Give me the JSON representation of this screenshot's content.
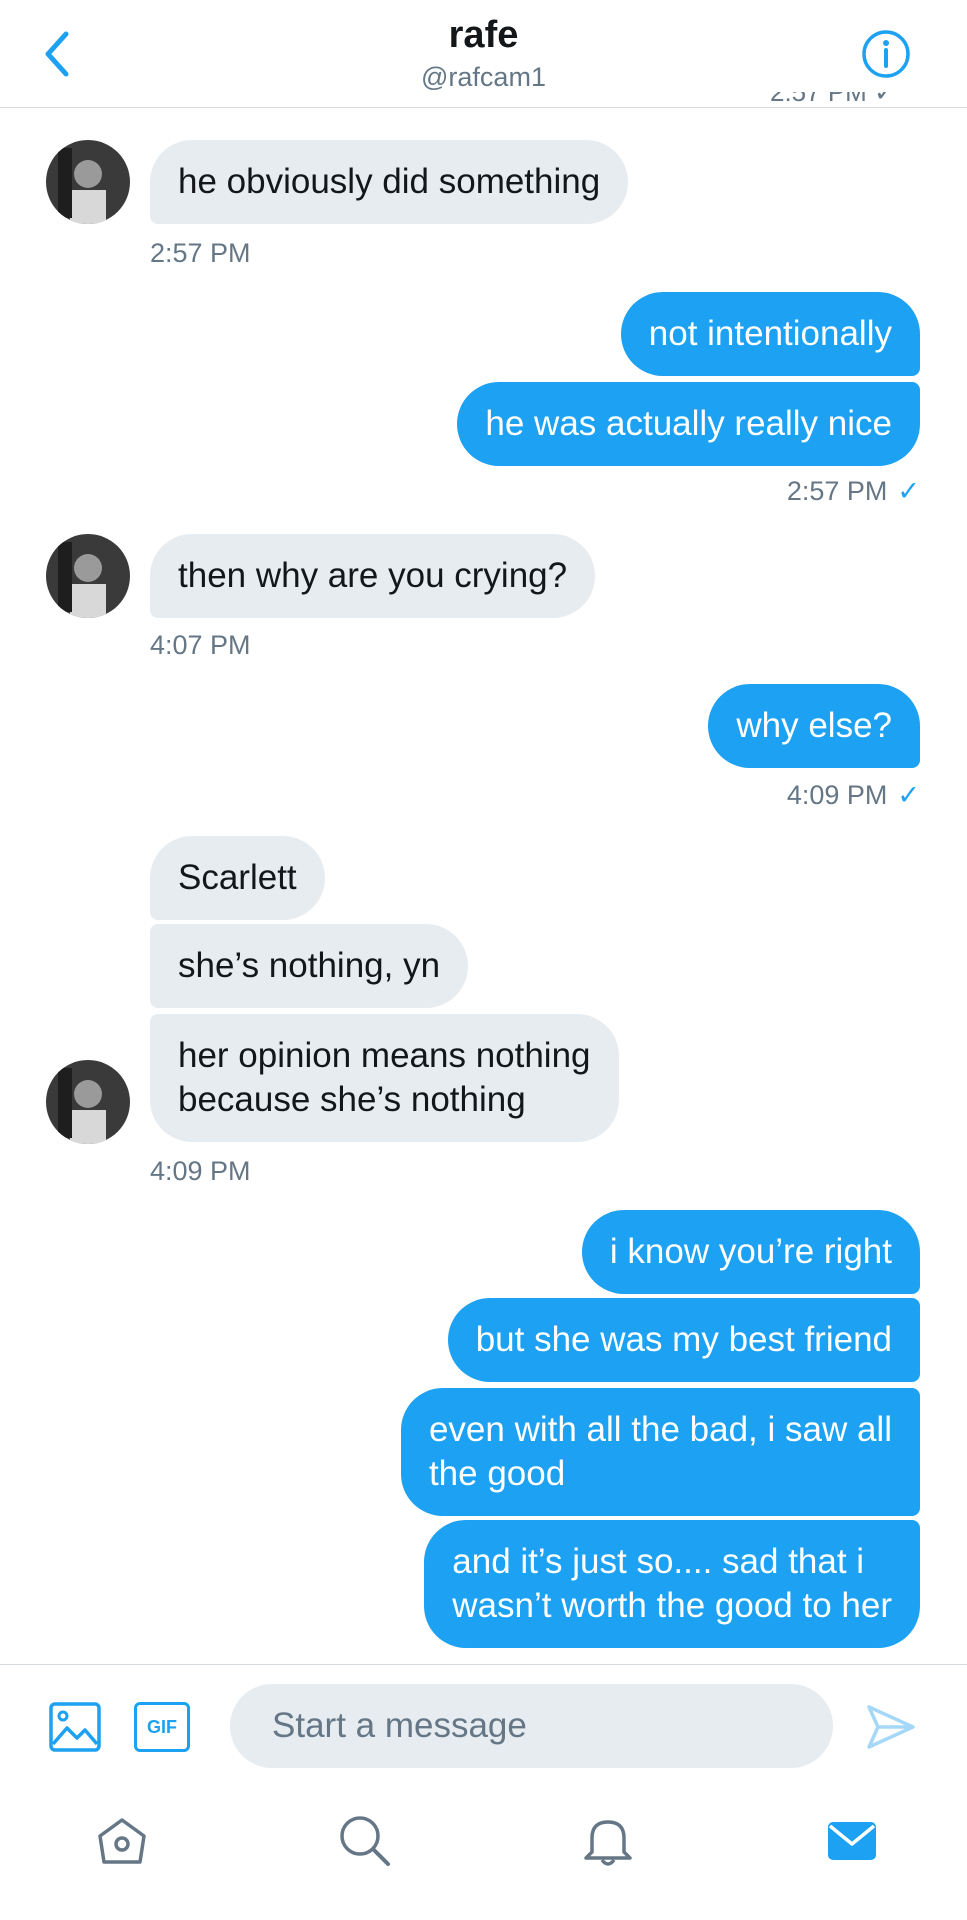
{
  "header": {
    "title": "rafe",
    "handle": "@rafcam1",
    "cut_timestamp": "2:57 PM ✓"
  },
  "messages": [
    {
      "direction": "in",
      "text": "he obviously did something"
    },
    {
      "direction": "in",
      "time": "2:57 PM"
    },
    {
      "direction": "out",
      "text": "not intentionally"
    },
    {
      "direction": "out",
      "text": "he was actually really nice"
    },
    {
      "direction": "out",
      "time": "2:57 PM",
      "read_check": "✓"
    },
    {
      "direction": "in",
      "text": "then why are you crying?"
    },
    {
      "direction": "in",
      "time": "4:07 PM"
    },
    {
      "direction": "out",
      "text": "why else?"
    },
    {
      "direction": "out",
      "time": "4:09 PM",
      "read_check": "✓"
    },
    {
      "direction": "in",
      "text": "Scarlett"
    },
    {
      "direction": "in",
      "text": "she’s nothing, yn"
    },
    {
      "direction": "in",
      "text": "her opinion means nothing\nbecause she’s nothing"
    },
    {
      "direction": "in",
      "time": "4:09 PM"
    },
    {
      "direction": "out",
      "text": "i know you’re right"
    },
    {
      "direction": "out",
      "text": "but she was my best friend"
    },
    {
      "direction": "out",
      "text": "even with all the bad, i saw all\nthe good"
    },
    {
      "direction": "out",
      "text": "and it’s just so.... sad that i\nwasn’t worth the good to her"
    }
  ],
  "composer": {
    "placeholder": "Start a message",
    "gif_label": "GIF"
  },
  "tabs": [
    {
      "name": "home",
      "icon": "home-icon",
      "active": false
    },
    {
      "name": "search",
      "icon": "search-icon",
      "active": false
    },
    {
      "name": "notifications",
      "icon": "bell-icon",
      "active": false
    },
    {
      "name": "messages",
      "icon": "mail-icon",
      "active": true
    }
  ],
  "colors": {
    "accent": "#1da1f2",
    "incoming_bubble": "#e6ecf0",
    "secondary_text": "#657786",
    "primary_text": "#14171a"
  }
}
